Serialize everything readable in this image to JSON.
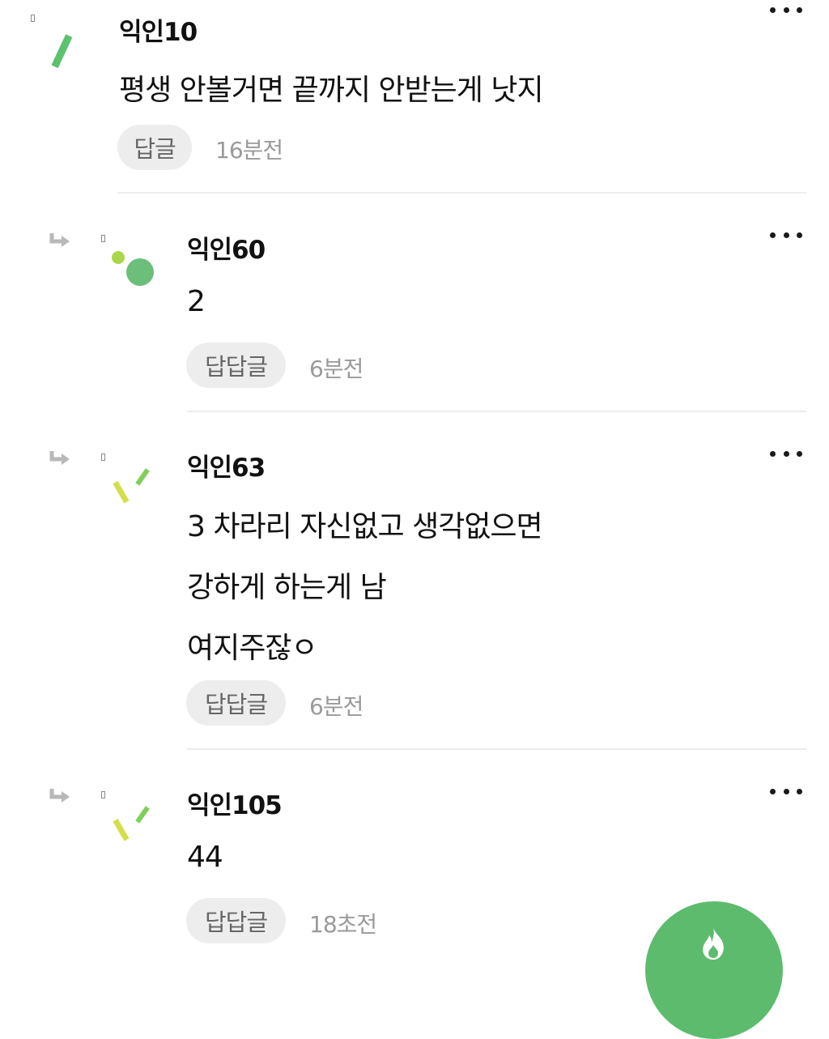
{
  "comments": [
    {
      "name": "익인10",
      "lines": [
        "평생 안볼거면 끝까지 안받는게 낫지"
      ],
      "reply_label": "답글",
      "time": "16분전",
      "is_reply": false
    },
    {
      "name": "익인60",
      "lines": [
        "2"
      ],
      "reply_label": "답답글",
      "time": "6분전",
      "is_reply": true
    },
    {
      "name": "익인63",
      "lines": [
        "3 차라리 자신없고 생각없으면",
        "강하게 하는게 남",
        "여지주잖ㅇ"
      ],
      "reply_label": "답답글",
      "time": "6분전",
      "is_reply": true
    },
    {
      "name": "익인105",
      "lines": [
        "44"
      ],
      "reply_label": "답답글",
      "time": "18초전",
      "is_reply": true
    }
  ],
  "colors": {
    "accent_green": "#5dbb6d",
    "avatar_lime": "#cfe04a",
    "avatar_green": "#6cbf7a"
  },
  "icons": {
    "more": "more-options-icon",
    "reply_arrow": "reply-arrow-icon",
    "fab": "fire-icon"
  }
}
